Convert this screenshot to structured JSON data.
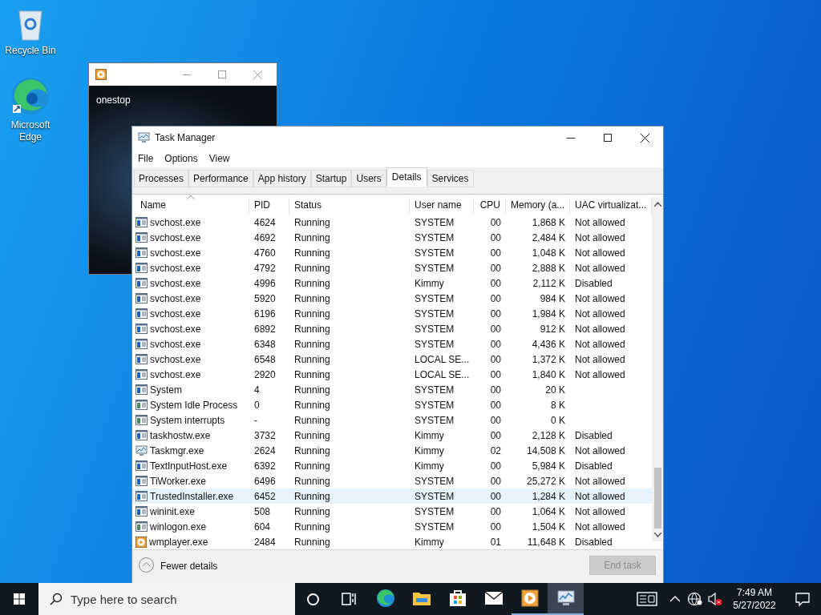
{
  "desktop_icons": [
    {
      "kind": "recycle",
      "label": "Recycle Bin"
    },
    {
      "kind": "edge",
      "label": "Microsoft Edge"
    }
  ],
  "player_window": {
    "caption": "onestop"
  },
  "task_manager": {
    "title": "Task Manager",
    "menu": [
      "File",
      "Options",
      "View"
    ],
    "tabs": [
      {
        "label": "Processes",
        "selected": false
      },
      {
        "label": "Performance",
        "selected": false
      },
      {
        "label": "App history",
        "selected": false
      },
      {
        "label": "Startup",
        "selected": false
      },
      {
        "label": "Users",
        "selected": false
      },
      {
        "label": "Details",
        "selected": true
      },
      {
        "label": "Services",
        "selected": false
      }
    ],
    "columns": [
      {
        "label": "Name",
        "sorted": true
      },
      {
        "label": "PID",
        "sorted": false
      },
      {
        "label": "Status",
        "sorted": false
      },
      {
        "label": "User name",
        "sorted": false
      },
      {
        "label": "CPU",
        "sorted": false
      },
      {
        "label": "Memory (a...",
        "sorted": false
      },
      {
        "label": "UAC virtualizat...",
        "sorted": false
      }
    ],
    "rows": [
      {
        "kind": "service",
        "cells": [
          "svchost.exe",
          "4624",
          "Running",
          "SYSTEM",
          "00",
          "1,868 K",
          "Not allowed"
        ],
        "selected": false
      },
      {
        "kind": "service",
        "cells": [
          "svchost.exe",
          "4692",
          "Running",
          "SYSTEM",
          "00",
          "2,484 K",
          "Not allowed"
        ],
        "selected": false
      },
      {
        "kind": "service",
        "cells": [
          "svchost.exe",
          "4760",
          "Running",
          "SYSTEM",
          "00",
          "1,048 K",
          "Not allowed"
        ],
        "selected": false
      },
      {
        "kind": "service",
        "cells": [
          "svchost.exe",
          "4792",
          "Running",
          "SYSTEM",
          "00",
          "2,888 K",
          "Not allowed"
        ],
        "selected": false
      },
      {
        "kind": "service",
        "cells": [
          "svchost.exe",
          "4996",
          "Running",
          "Kimmy",
          "00",
          "2,112 K",
          "Disabled"
        ],
        "selected": false
      },
      {
        "kind": "service",
        "cells": [
          "svchost.exe",
          "5920",
          "Running",
          "SYSTEM",
          "00",
          "984 K",
          "Not allowed"
        ],
        "selected": false
      },
      {
        "kind": "service",
        "cells": [
          "svchost.exe",
          "6196",
          "Running",
          "SYSTEM",
          "00",
          "1,984 K",
          "Not allowed"
        ],
        "selected": false
      },
      {
        "kind": "service",
        "cells": [
          "svchost.exe",
          "6892",
          "Running",
          "SYSTEM",
          "00",
          "912 K",
          "Not allowed"
        ],
        "selected": false
      },
      {
        "kind": "service",
        "cells": [
          "svchost.exe",
          "6348",
          "Running",
          "SYSTEM",
          "00",
          "4,436 K",
          "Not allowed"
        ],
        "selected": false
      },
      {
        "kind": "service",
        "cells": [
          "svchost.exe",
          "6548",
          "Running",
          "LOCAL SE...",
          "00",
          "1,372 K",
          "Not allowed"
        ],
        "selected": false
      },
      {
        "kind": "service",
        "cells": [
          "svchost.exe",
          "2920",
          "Running",
          "LOCAL SE...",
          "00",
          "1,840 K",
          "Not allowed"
        ],
        "selected": false
      },
      {
        "kind": "service",
        "cells": [
          "System",
          "4",
          "Running",
          "SYSTEM",
          "00",
          "20 K"
        ],
        "selected": false
      },
      {
        "kind": "system",
        "cells": [
          "System Idle Process",
          "0",
          "Running",
          "SYSTEM",
          "00",
          "8 K"
        ],
        "selected": false
      },
      {
        "kind": "system",
        "cells": [
          "System interrupts",
          "-",
          "Running",
          "SYSTEM",
          "00",
          "0 K"
        ],
        "selected": false
      },
      {
        "kind": "service",
        "cells": [
          "taskhostw.exe",
          "3732",
          "Running",
          "Kimmy",
          "00",
          "2,128 K",
          "Disabled"
        ],
        "selected": false
      },
      {
        "kind": "taskmgr",
        "cells": [
          "Taskmgr.exe",
          "2624",
          "Running",
          "Kimmy",
          "02",
          "14,508 K",
          "Not allowed"
        ],
        "selected": false
      },
      {
        "kind": "service",
        "cells": [
          "TextInputHost.exe",
          "6392",
          "Running",
          "Kimmy",
          "00",
          "5,984 K",
          "Disabled"
        ],
        "selected": false
      },
      {
        "kind": "service",
        "cells": [
          "TiWorker.exe",
          "6496",
          "Running",
          "SYSTEM",
          "00",
          "25,272 K",
          "Not allowed"
        ],
        "selected": false
      },
      {
        "kind": "service",
        "cells": [
          "TrustedInstaller.exe",
          "6452",
          "Running",
          "SYSTEM",
          "00",
          "1,284 K",
          "Not allowed"
        ],
        "selected": true
      },
      {
        "kind": "service",
        "cells": [
          "wininit.exe",
          "508",
          "Running",
          "SYSTEM",
          "00",
          "1,064 K",
          "Not allowed"
        ],
        "selected": false
      },
      {
        "kind": "system",
        "cells": [
          "winlogon.exe",
          "604",
          "Running",
          "SYSTEM",
          "00",
          "1,504 K",
          "Not allowed"
        ],
        "selected": false
      },
      {
        "kind": "media",
        "cells": [
          "wmplayer.exe",
          "2484",
          "Running",
          "Kimmy",
          "01",
          "11,648 K",
          "Disabled"
        ],
        "selected": false
      }
    ],
    "footer": {
      "toggle": "Fewer details",
      "end_task": {
        "label": "End task",
        "disabled": true
      }
    }
  },
  "taskbar": {
    "search_placeholder": "Type here to search",
    "apps": [
      {
        "kind": "edge",
        "active": false
      },
      {
        "kind": "folder",
        "active": false
      },
      {
        "kind": "store",
        "active": false
      },
      {
        "kind": "mail",
        "active": false
      },
      {
        "kind": "media",
        "active": true
      },
      {
        "kind": "taskmgr",
        "active": true
      }
    ],
    "time": "7:49 AM",
    "date": "5/27/2022"
  }
}
